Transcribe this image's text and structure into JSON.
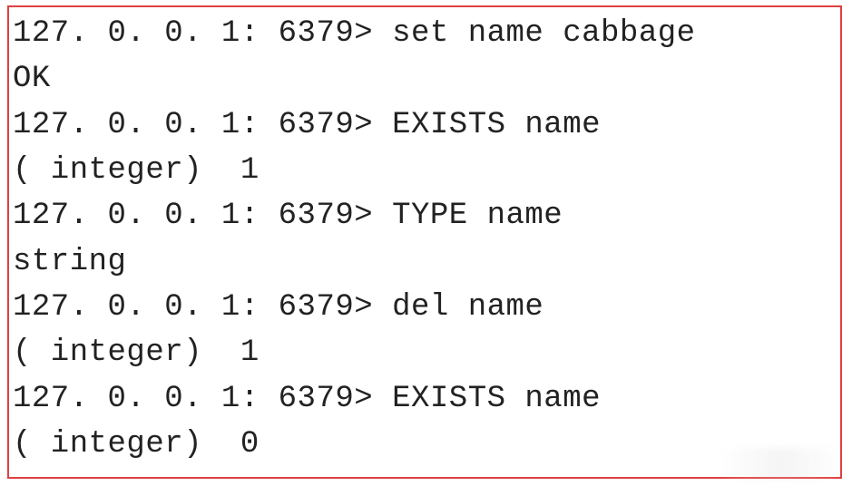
{
  "terminal": {
    "prompt": "127. 0. 0. 1: 6379> ",
    "lines": [
      {
        "type": "cmd",
        "command": "set name cabbage"
      },
      {
        "type": "out",
        "text": "OK"
      },
      {
        "type": "cmd",
        "command": "EXISTS name"
      },
      {
        "type": "out",
        "text": "( integer)  1"
      },
      {
        "type": "cmd",
        "command": "TYPE name"
      },
      {
        "type": "out",
        "text": "string"
      },
      {
        "type": "cmd",
        "command": "del name"
      },
      {
        "type": "out",
        "text": "( integer)  1"
      },
      {
        "type": "cmd",
        "command": "EXISTS name"
      },
      {
        "type": "out",
        "text": "( integer)  0"
      }
    ]
  }
}
